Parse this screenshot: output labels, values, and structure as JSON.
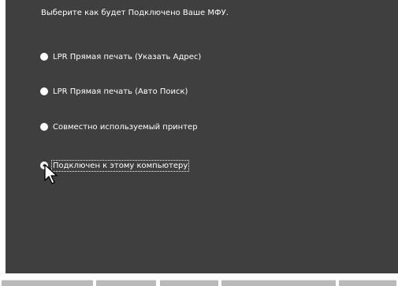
{
  "dialog": {
    "heading": "Выберите как будет Подключено Ваше МФУ.",
    "options": [
      {
        "label": "LPR Прямая печать (Указать Адрес)",
        "selected": false
      },
      {
        "label": "LPR Прямая печать (Авто Поиск)",
        "selected": false
      },
      {
        "label": "Совместно используемый принтер",
        "selected": false
      },
      {
        "label": "Подключен к этому компьютеру",
        "selected": true
      }
    ]
  },
  "colors": {
    "panel_background": "#3f3f3f",
    "text": "#ffffff"
  },
  "icons": {
    "radio": "radio-button-icon",
    "cursor": "mouse-pointer-icon"
  }
}
